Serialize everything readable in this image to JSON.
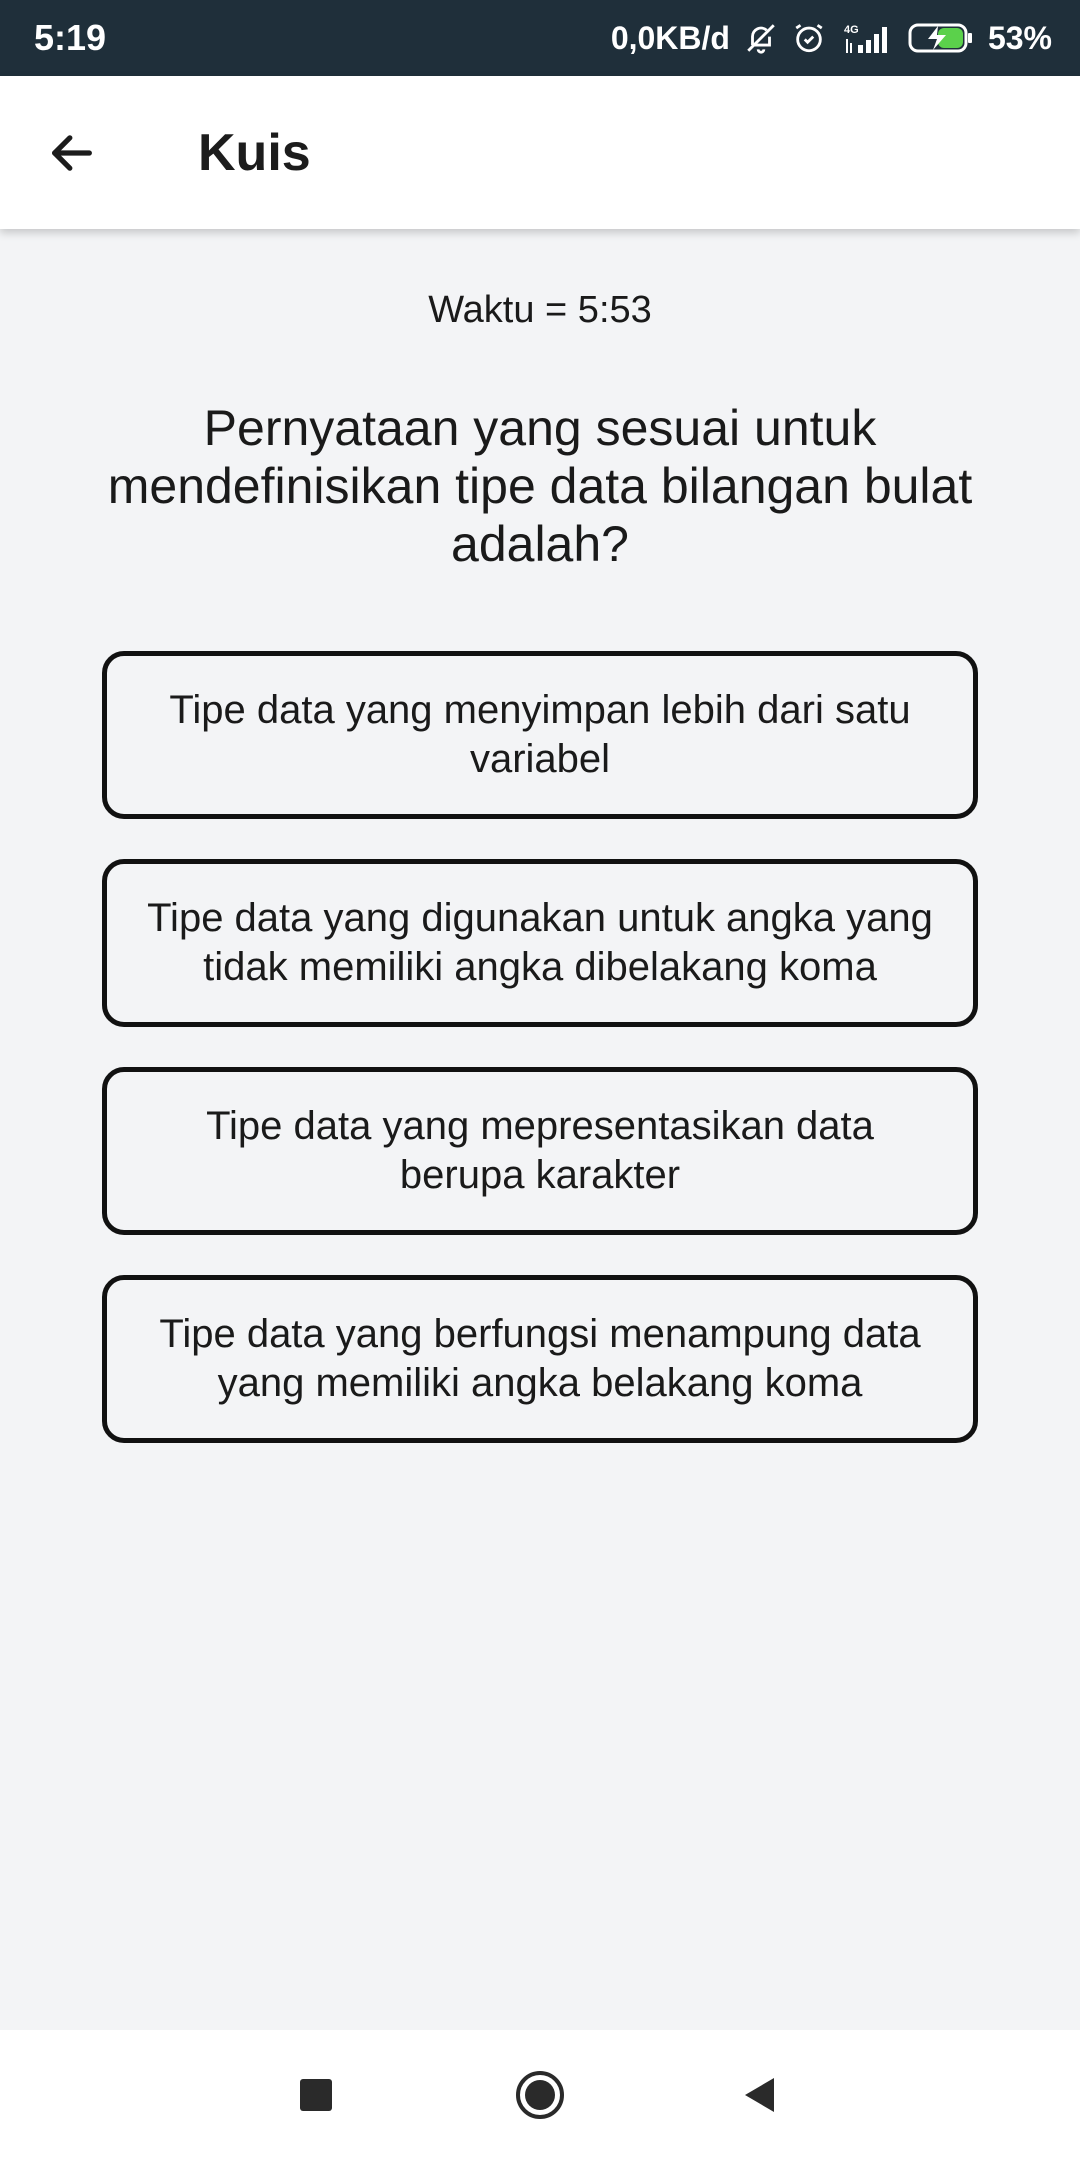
{
  "status_bar": {
    "time": "5:19",
    "network_speed": "0,0KB/d",
    "network_type": "4G",
    "battery": "53%",
    "icons": [
      "bell-off-icon",
      "alarm-icon",
      "signal-icon",
      "battery-charging-icon"
    ]
  },
  "app_bar": {
    "title": "Kuis",
    "back_icon": "arrow-left-icon"
  },
  "quiz": {
    "timer": "Waktu = 5:53",
    "question": "Pernyataan yang sesuai untuk mendefinisikan tipe data bilangan bulat adalah?",
    "options": [
      {
        "label": "Tipe data yang menyimpan lebih dari satu variabel"
      },
      {
        "label": "Tipe data yang digunakan untuk angka yang tidak memiliki angka dibelakang koma"
      },
      {
        "label": "Tipe data yang mepresentasikan data berupa karakter"
      },
      {
        "label": "Tipe data yang berfungsi menampung data yang memiliki angka belakang koma"
      }
    ]
  },
  "nav_bar": {
    "icons": [
      "recents-square-icon",
      "home-circle-icon",
      "back-triangle-icon"
    ]
  },
  "colors": {
    "status_bar_bg": "#1f2f3a",
    "app_bar_bg": "#ffffff",
    "content_bg": "#f3f4f6",
    "option_border": "#111111",
    "battery_accent": "#5bd14b"
  }
}
